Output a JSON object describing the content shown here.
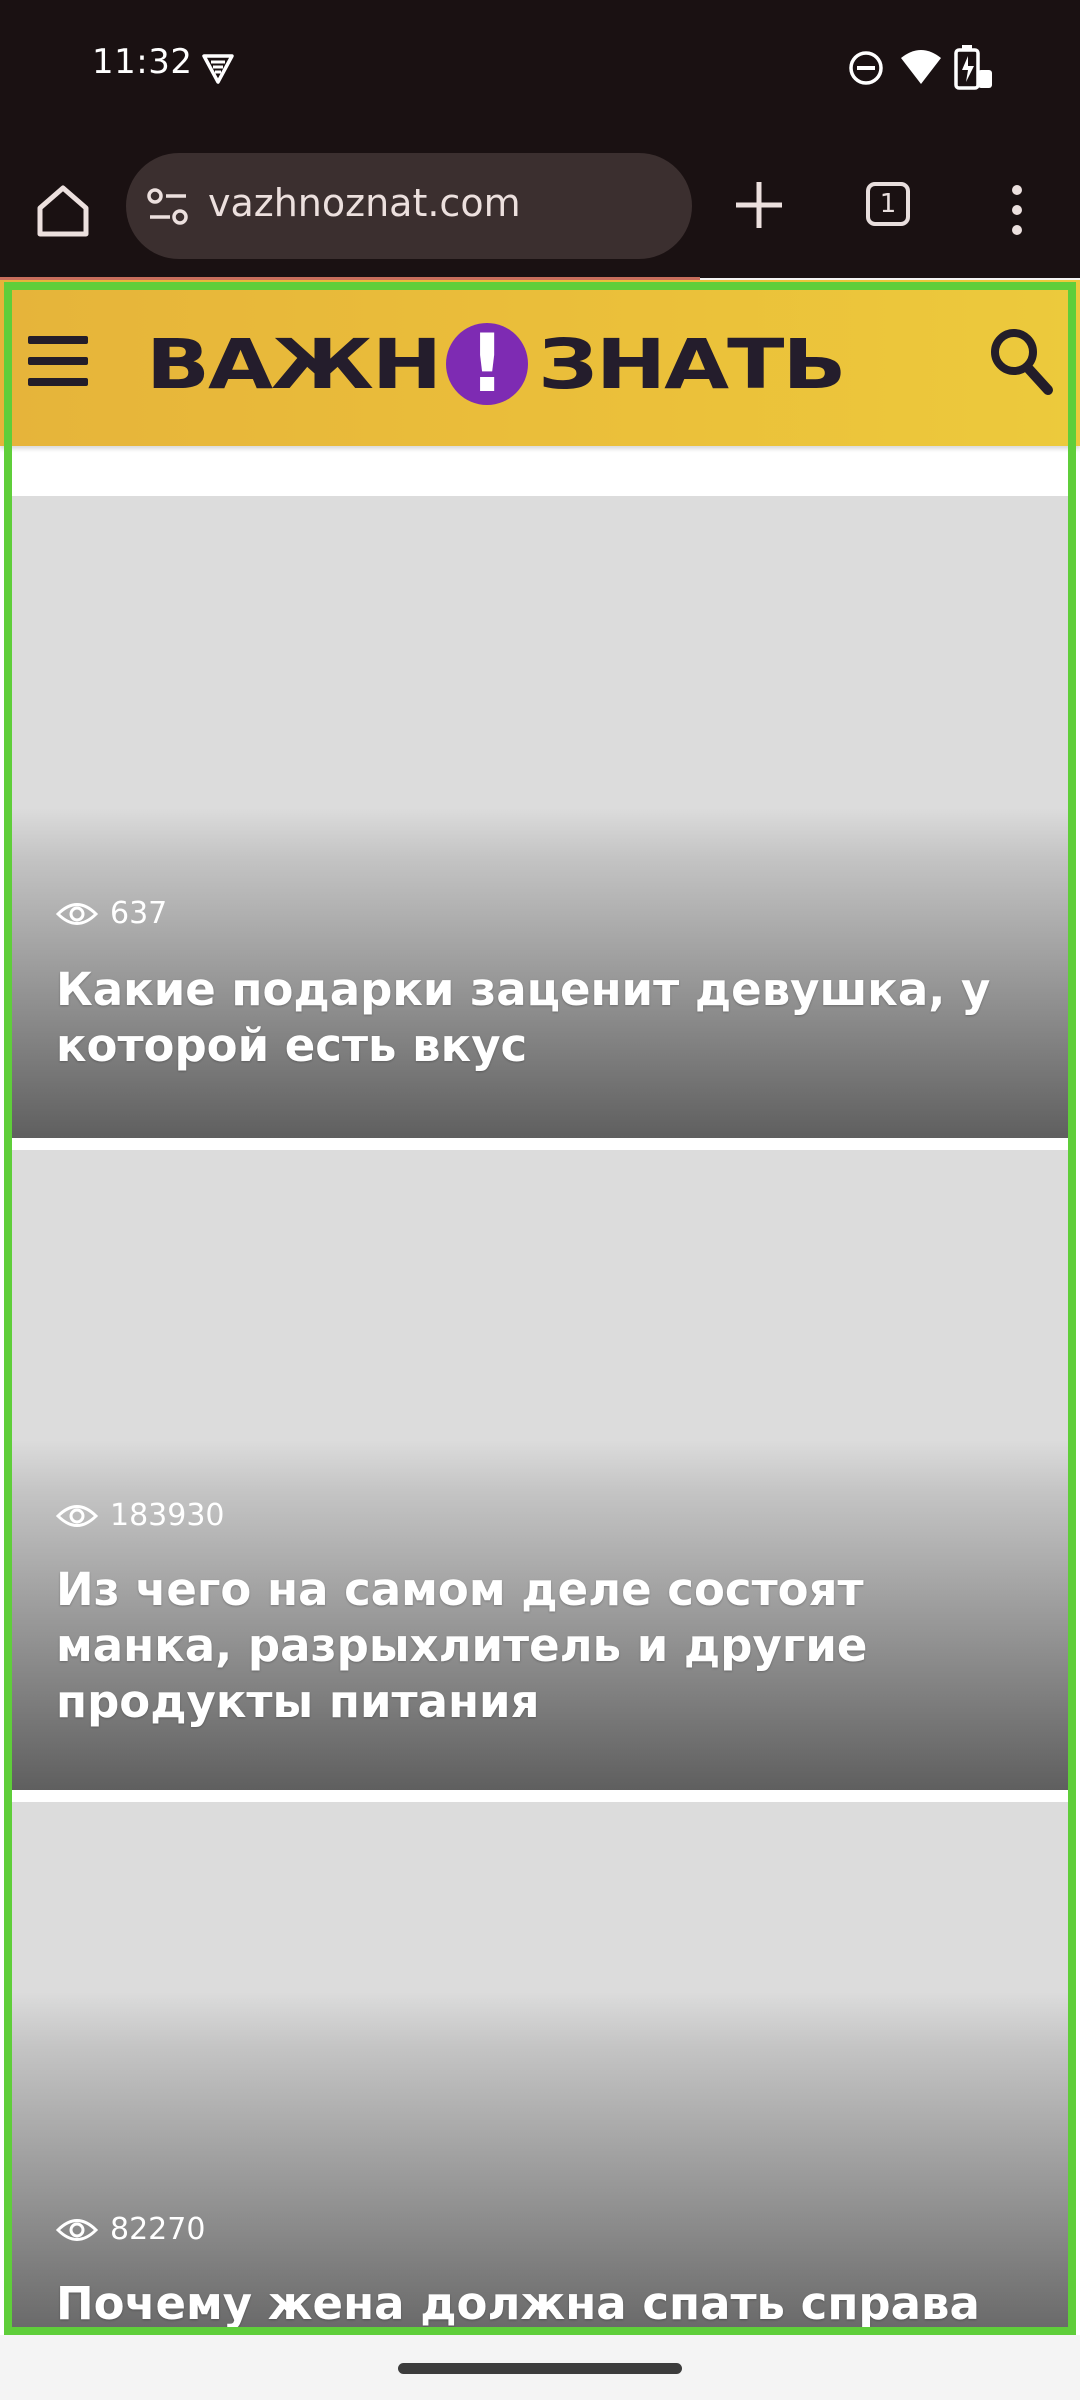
{
  "status_bar": {
    "time": "11:32",
    "icons": [
      "vpn-icon",
      "do-not-disturb-icon",
      "wifi-icon",
      "battery-charging-icon"
    ]
  },
  "browser": {
    "url": "vazhnoznat.com",
    "tab_count": "1",
    "icons": [
      "home-icon",
      "site-settings-icon",
      "new-tab-icon",
      "tab-switcher-icon",
      "more-menu-icon"
    ]
  },
  "site": {
    "logo_left": "ВАЖН",
    "logo_mark": "!",
    "logo_right": "ЗНАТЬ",
    "brand_colors": {
      "header": "#ebc03a",
      "logo_text": "#241d2c",
      "logo_mark": "#7e2bb3"
    }
  },
  "articles": [
    {
      "views": "637",
      "title": "Какие подарки заценит девушка, у которой есть вкус"
    },
    {
      "views": "183930",
      "title": "Из чего на самом деле состоят манка, разрыхлитель и другие продукты питания"
    },
    {
      "views": "82270",
      "title": "Почему жена должна спать справа от"
    }
  ]
}
